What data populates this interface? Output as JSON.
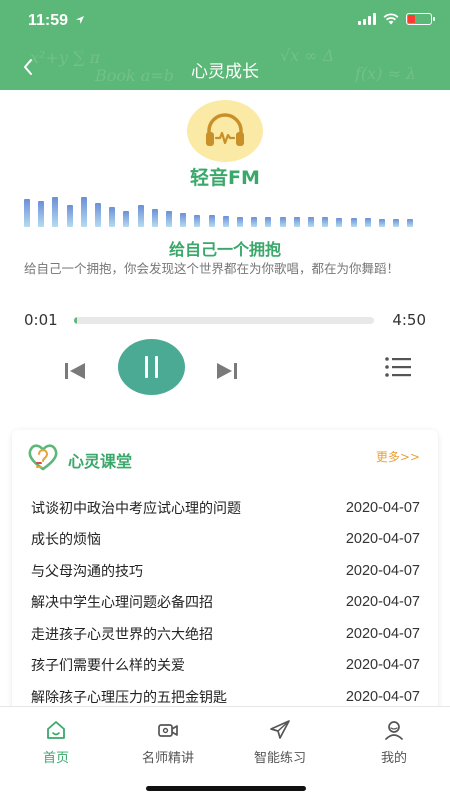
{
  "status_bar": {
    "time": "11:59",
    "location_icon": "location-arrow-icon",
    "battery_level": 0.3,
    "battery_color": "#ff3b30"
  },
  "nav": {
    "title": "心灵成长",
    "back_icon": "chevron-left-icon"
  },
  "fm": {
    "logo_icon": "headphones-icon",
    "title": "轻音FM"
  },
  "player": {
    "track_title": "给自己一个拥抱",
    "track_desc": "给自己一个拥抱，你会发现这个世界都在为你歌唱，都在为你舞蹈！",
    "current_time": "0:01",
    "total_time": "4:50",
    "progress": 0.003
  },
  "card": {
    "title": "心灵课堂",
    "more_label": "更多>>",
    "items": [
      {
        "title": "试谈初中政治中考应试心理的问题",
        "date": "2020-04-07"
      },
      {
        "title": "成长的烦恼",
        "date": "2020-04-07"
      },
      {
        "title": "与父母沟通的技巧",
        "date": "2020-04-07"
      },
      {
        "title": "解决中学生心理问题必备四招",
        "date": "2020-04-07"
      },
      {
        "title": "走进孩子心灵世界的六大绝招",
        "date": "2020-04-07"
      },
      {
        "title": "孩子们需要什么样的关爱",
        "date": "2020-04-07"
      },
      {
        "title": "解除孩子心理压力的五把金钥匙",
        "date": "2020-04-07"
      }
    ]
  },
  "tabs": [
    {
      "label": "首页",
      "icon": "home-icon",
      "active": true
    },
    {
      "label": "名师精讲",
      "icon": "video-camera-icon",
      "active": false
    },
    {
      "label": "智能练习",
      "icon": "paper-plane-icon",
      "active": false
    },
    {
      "label": "我的",
      "icon": "user-icon",
      "active": false
    }
  ],
  "colors": {
    "primary": "#5cb878",
    "accent_text": "#3aa86a",
    "play_button": "#4aaa94",
    "more_link": "#e8a23a"
  }
}
